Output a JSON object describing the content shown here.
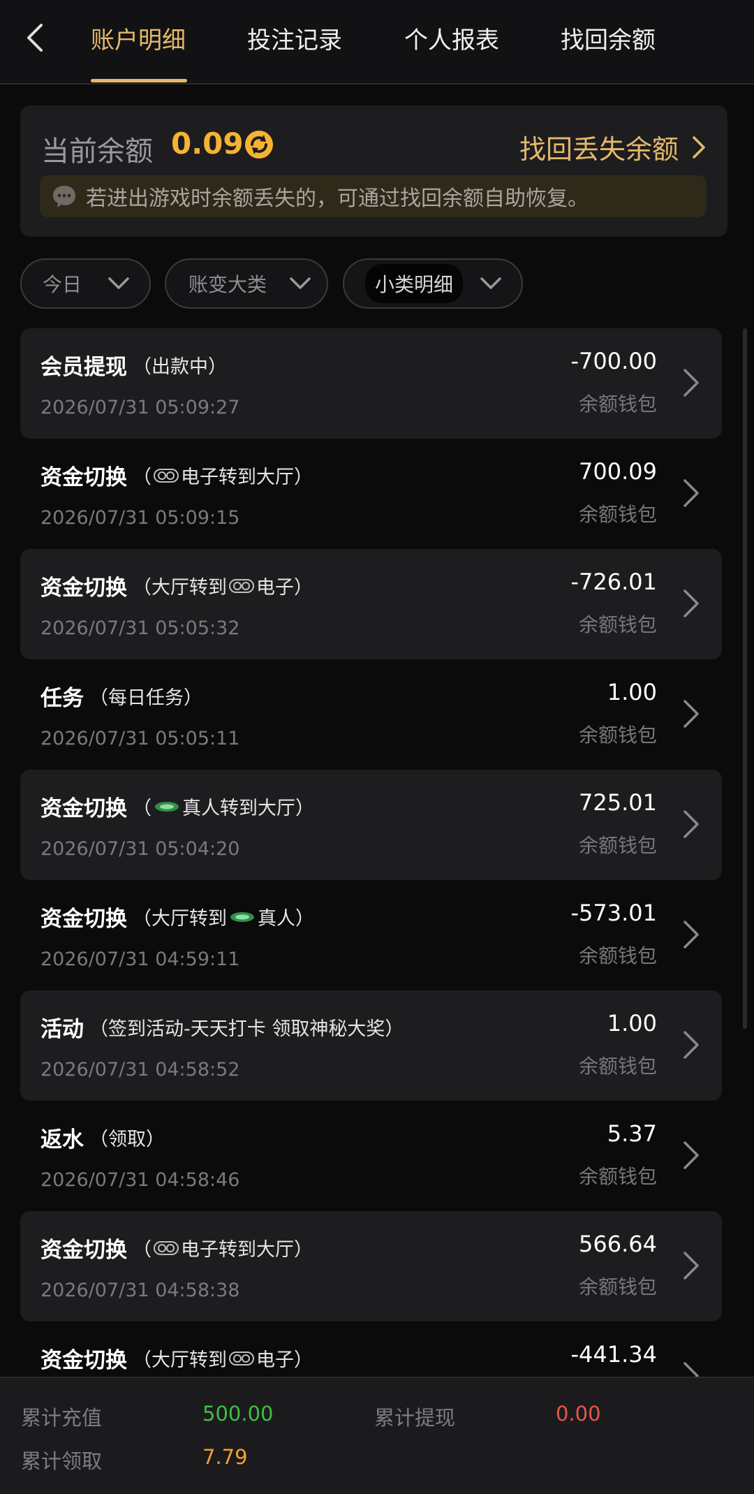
{
  "header": {
    "back_icon": "chevron-left-icon",
    "tabs": [
      {
        "label": "账户明细",
        "active": true
      },
      {
        "label": "投注记录",
        "active": false
      },
      {
        "label": "个人报表",
        "active": false
      },
      {
        "label": "找回余额",
        "active": false
      }
    ]
  },
  "balance": {
    "label": "当前余额",
    "value": "0.09",
    "refresh_icon": "refresh-icon",
    "recover_link": "找回丢失余额",
    "notice": "若进出游戏时余额丢失的，可通过找回余额自助恢复。"
  },
  "filters": [
    {
      "label": "今日"
    },
    {
      "label": "账变大类"
    },
    {
      "label": "小类明细"
    }
  ],
  "transactions": [
    {
      "title": "会员提现",
      "sub_before": "（出款中）",
      "logo": "",
      "sub_after": "",
      "time": "2026/07/31 05:09:27",
      "amount": "-700.00",
      "wallet": "余额钱包"
    },
    {
      "title": "资金切换",
      "sub_before": "（",
      "logo": "pg",
      "sub_after": "电子转到大厅）",
      "time": "2026/07/31 05:09:15",
      "amount": "700.09",
      "wallet": "余额钱包"
    },
    {
      "title": "资金切换",
      "sub_before": "（大厅转到",
      "logo": "pg",
      "sub_after": "电子）",
      "time": "2026/07/31 05:05:32",
      "amount": "-726.01",
      "wallet": "余额钱包"
    },
    {
      "title": "任务",
      "sub_before": "（每日任务）",
      "logo": "",
      "sub_after": "",
      "time": "2026/07/31 05:05:11",
      "amount": "1.00",
      "wallet": "余额钱包"
    },
    {
      "title": "资金切换",
      "sub_before": "（",
      "logo": "live",
      "sub_after": "真人转到大厅）",
      "time": "2026/07/31 05:04:20",
      "amount": "725.01",
      "wallet": "余额钱包"
    },
    {
      "title": "资金切换",
      "sub_before": "（大厅转到",
      "logo": "live",
      "sub_after": "真人）",
      "time": "2026/07/31 04:59:11",
      "amount": "-573.01",
      "wallet": "余额钱包"
    },
    {
      "title": "活动",
      "sub_before": "（签到活动-天天打卡 领取神秘大奖）",
      "logo": "",
      "sub_after": "",
      "time": "2026/07/31 04:58:52",
      "amount": "1.00",
      "wallet": "余额钱包"
    },
    {
      "title": "返水",
      "sub_before": "（领取）",
      "logo": "",
      "sub_after": "",
      "time": "2026/07/31 04:58:46",
      "amount": "5.37",
      "wallet": "余额钱包"
    },
    {
      "title": "资金切换",
      "sub_before": "（",
      "logo": "pg",
      "sub_after": "电子转到大厅）",
      "time": "2026/07/31 04:58:38",
      "amount": "566.64",
      "wallet": "余额钱包"
    },
    {
      "title": "资金切换",
      "sub_before": "（大厅转到",
      "logo": "pg",
      "sub_after": "电子）",
      "time": "",
      "amount": "-441.34",
      "wallet": ""
    }
  ],
  "summary": {
    "total_deposit_label": "累计充值",
    "total_deposit_value": "500.00",
    "total_withdraw_label": "累计提现",
    "total_withdraw_value": "0.00",
    "total_claimed_label": "累计领取",
    "total_claimed_value": "7.79"
  },
  "colors": {
    "accent_gold": "#e5b96a",
    "balance_orange": "#f6b233",
    "deposit_green": "#3fbf3f",
    "withdraw_red": "#e8544a",
    "claimed_orange": "#f0a030"
  }
}
